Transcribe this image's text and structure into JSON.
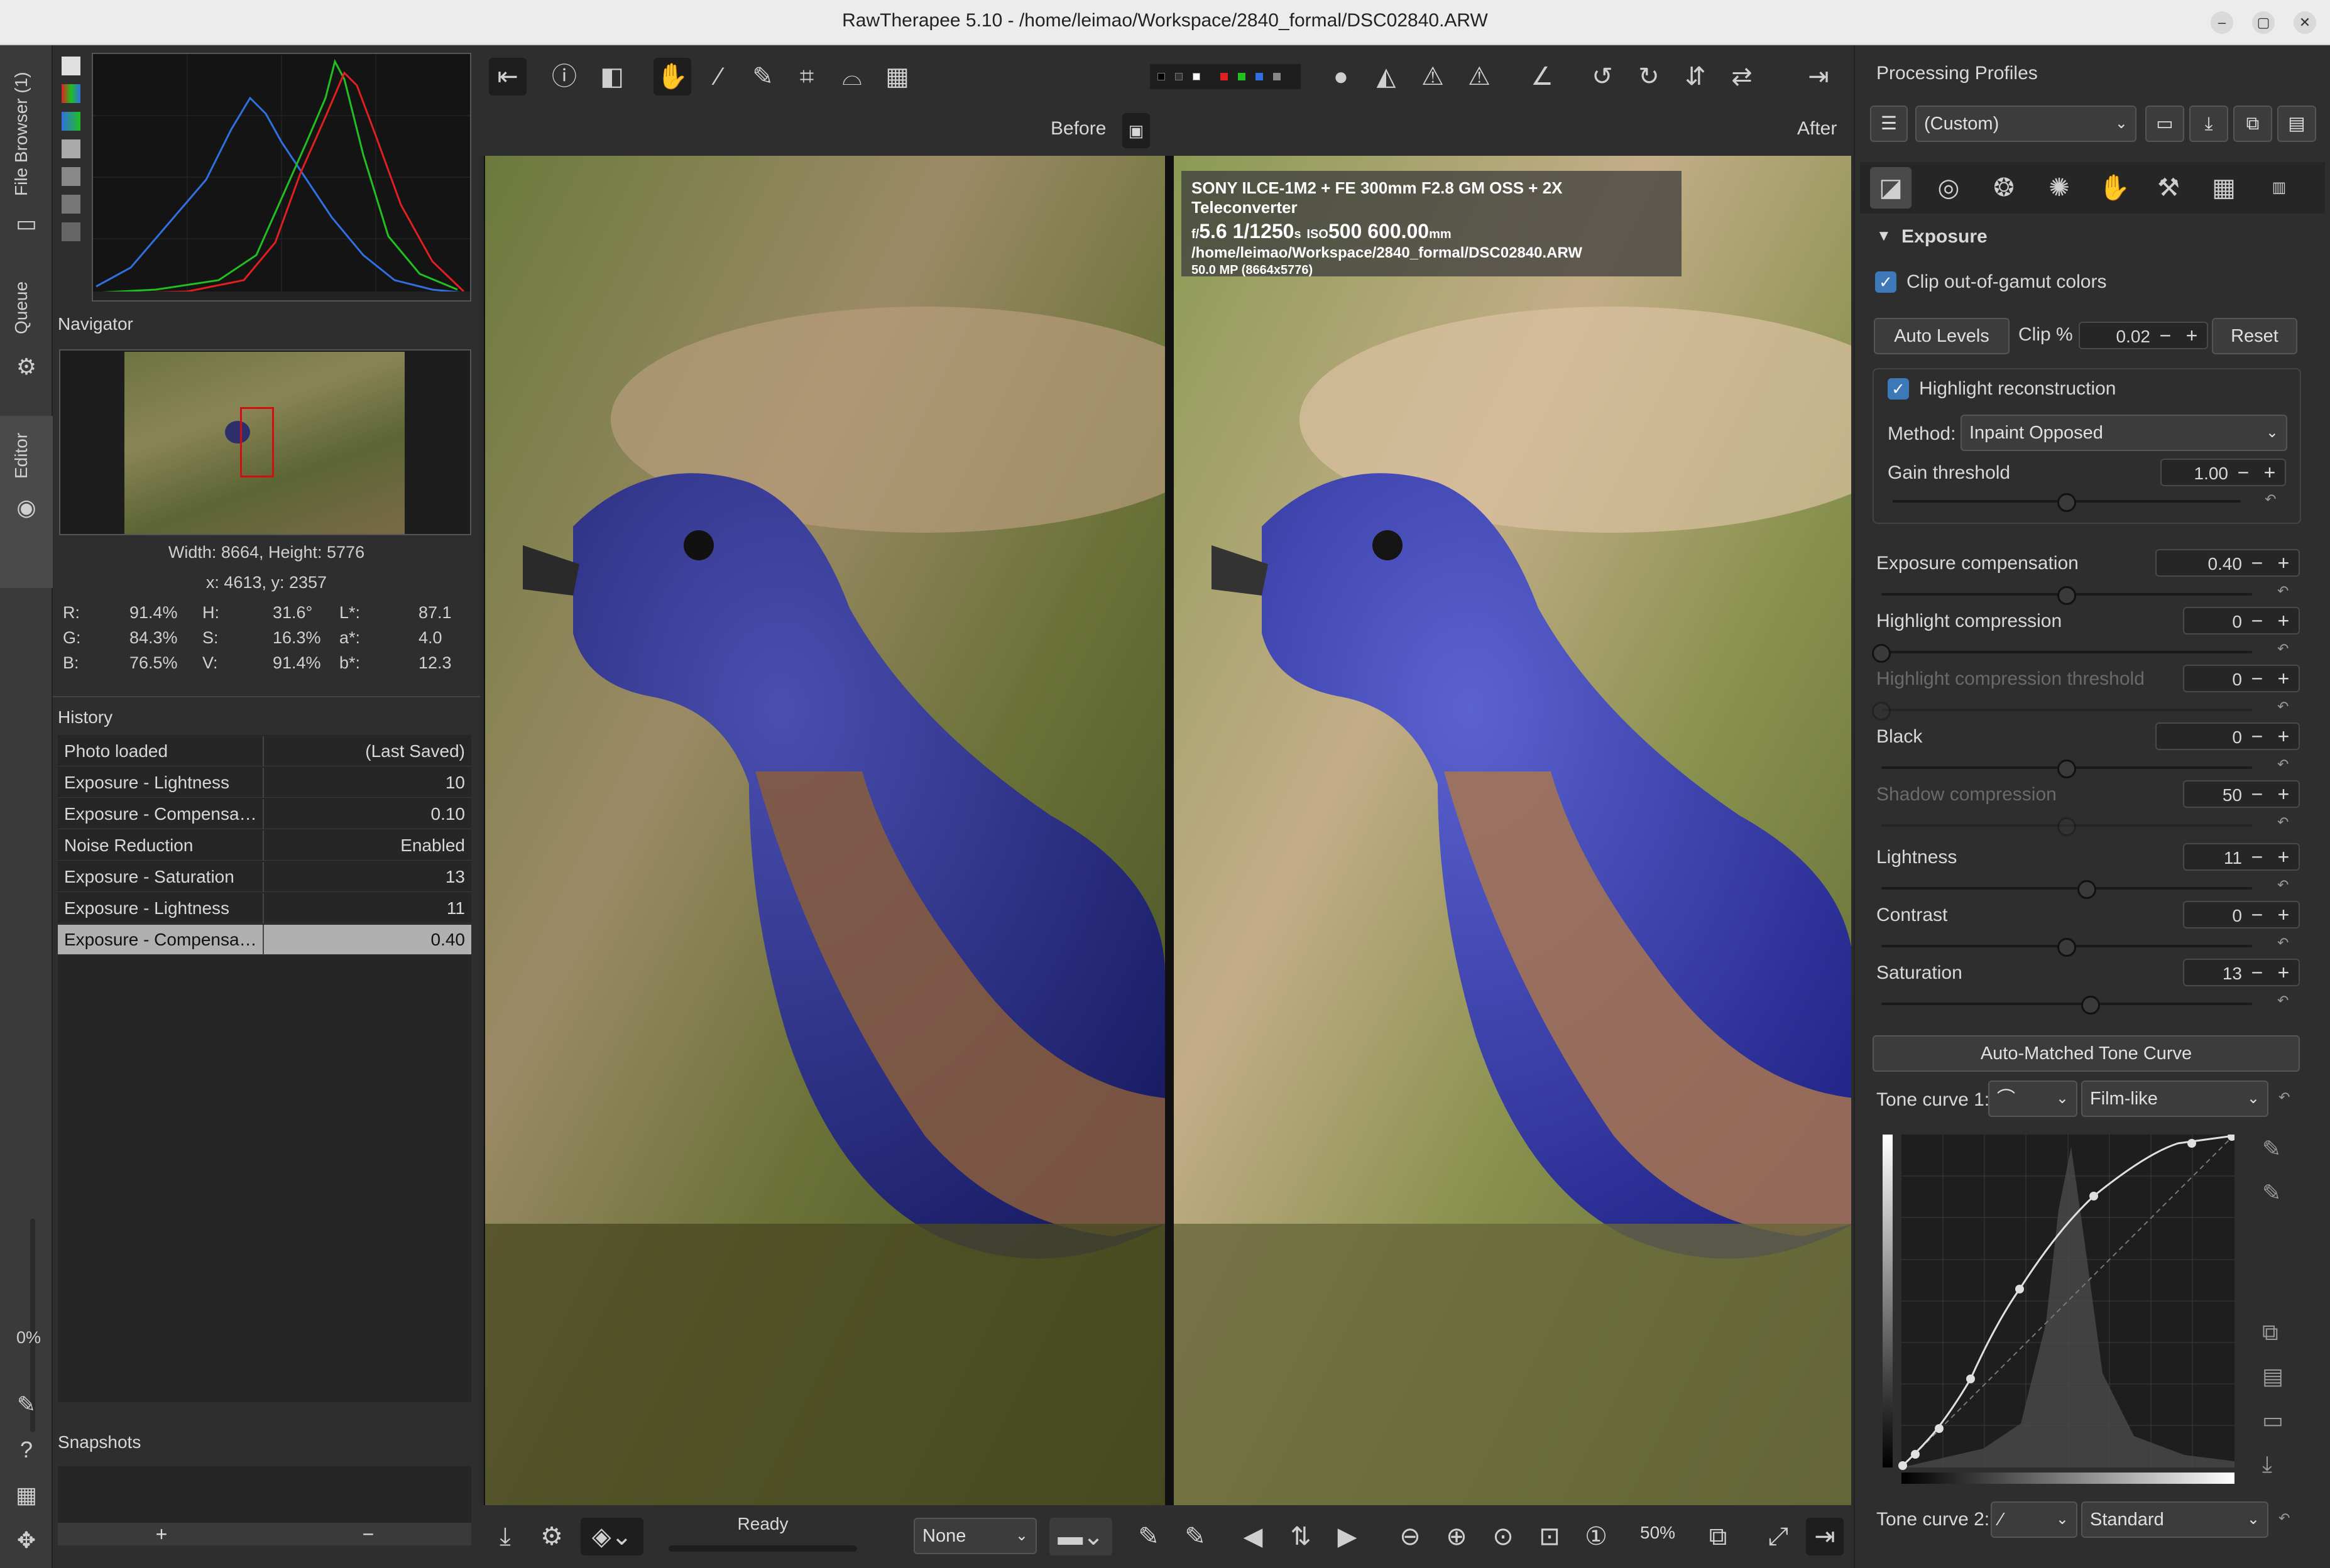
{
  "window": {
    "title": "RawTherapee 5.10 - /home/leimao/Workspace/2840_formal/DSC02840.ARW",
    "minimize": "–",
    "maximize": "▢",
    "close": "✕"
  },
  "left_tabs": {
    "file_browser": "File Browser (1)",
    "queue": "Queue",
    "editor": "Editor",
    "progress": "0%"
  },
  "navigator": {
    "title": "Navigator",
    "size": "Width: 8664, Height: 5776",
    "coords": "x: 4613, y: 2357",
    "info": [
      {
        "l1": "R:",
        "v1": "91.4%",
        "l2": "H:",
        "v2": "31.6°",
        "l3": "L*:",
        "v3": "87.1"
      },
      {
        "l1": "G:",
        "v1": "84.3%",
        "l2": "S:",
        "v2": "16.3%",
        "l3": "a*:",
        "v3": "4.0"
      },
      {
        "l1": "B:",
        "v1": "76.5%",
        "l2": "V:",
        "v2": "91.4%",
        "l3": "b*:",
        "v3": "12.3"
      }
    ]
  },
  "history": {
    "title": "History",
    "rows": [
      {
        "label": "Photo loaded",
        "value": "(Last Saved)"
      },
      {
        "label": "Exposure - Lightness",
        "value": "10"
      },
      {
        "label": "Exposure - Compensa…",
        "value": "0.10"
      },
      {
        "label": "Noise Reduction",
        "value": "Enabled"
      },
      {
        "label": "Exposure - Saturation",
        "value": "13"
      },
      {
        "label": "Exposure - Lightness",
        "value": "11"
      },
      {
        "label": "Exposure - Compensa…",
        "value": "0.40"
      }
    ],
    "selected_index": 6
  },
  "snapshots": {
    "title": "Snapshots",
    "add": "+",
    "remove": "−"
  },
  "preview": {
    "before": "Before",
    "after": "After"
  },
  "exif": {
    "camera": "SONY ILCE-1M2 + FE 300mm F2.8 GM OSS + 2X Teleconverter",
    "f_prefix": "f/",
    "aperture": "5.6",
    "shutter": "1/1250",
    "shutter_unit": "s",
    "iso_prefix": "ISO",
    "iso": "500",
    "focal": "600.00",
    "focal_unit": "mm",
    "path": "/home/leimao/Workspace/2840_formal/DSC02840.ARW",
    "mp": "50.0 MP (8664x5776)"
  },
  "bottombar": {
    "status": "Ready",
    "none": "None",
    "zoom": "50%"
  },
  "profiles": {
    "title": "Processing Profiles",
    "current": "(Custom)"
  },
  "exposure": {
    "title": "Exposure",
    "clip_gamut": "Clip out-of-gamut colors",
    "auto_levels": "Auto Levels",
    "clip_label": "Clip %",
    "clip_value": "0.02",
    "reset": "Reset",
    "hr_label": "Highlight reconstruction",
    "method_label": "Method:",
    "method_value": "Inpaint Opposed",
    "gain_label": "Gain threshold",
    "gain_value": "1.00",
    "sliders": [
      {
        "label": "Exposure compensation",
        "value": "0.40",
        "pos": 0.5,
        "enabled": true
      },
      {
        "label": "Highlight compression",
        "value": "0",
        "pos": 0.0,
        "enabled": true
      },
      {
        "label": "Highlight compression threshold",
        "value": "0",
        "pos": 0.0,
        "enabled": false
      },
      {
        "label": "Black",
        "value": "0",
        "pos": 0.5,
        "enabled": true
      },
      {
        "label": "Shadow compression",
        "value": "50",
        "pos": 0.5,
        "enabled": false
      },
      {
        "label": "Lightness",
        "value": "11",
        "pos": 0.555,
        "enabled": true
      },
      {
        "label": "Contrast",
        "value": "0",
        "pos": 0.5,
        "enabled": true
      },
      {
        "label": "Saturation",
        "value": "13",
        "pos": 0.565,
        "enabled": true
      }
    ],
    "gain_pos": 0.5,
    "auto_tone": "Auto-Matched Tone Curve",
    "tc1_label": "Tone curve 1:",
    "tc1_mode": "Film-like",
    "tc2_label": "Tone curve 2:",
    "tc2_mode": "Standard"
  },
  "colors": {
    "accent": "#3d78b8",
    "histogram_red": "#e02020",
    "histogram_green": "#20c020",
    "histogram_blue": "#3070e0"
  },
  "icons": {
    "minus": "−",
    "plus": "+",
    "check": "✓",
    "chevron": "⌄",
    "triangle": "▼",
    "lock": "🔒"
  }
}
